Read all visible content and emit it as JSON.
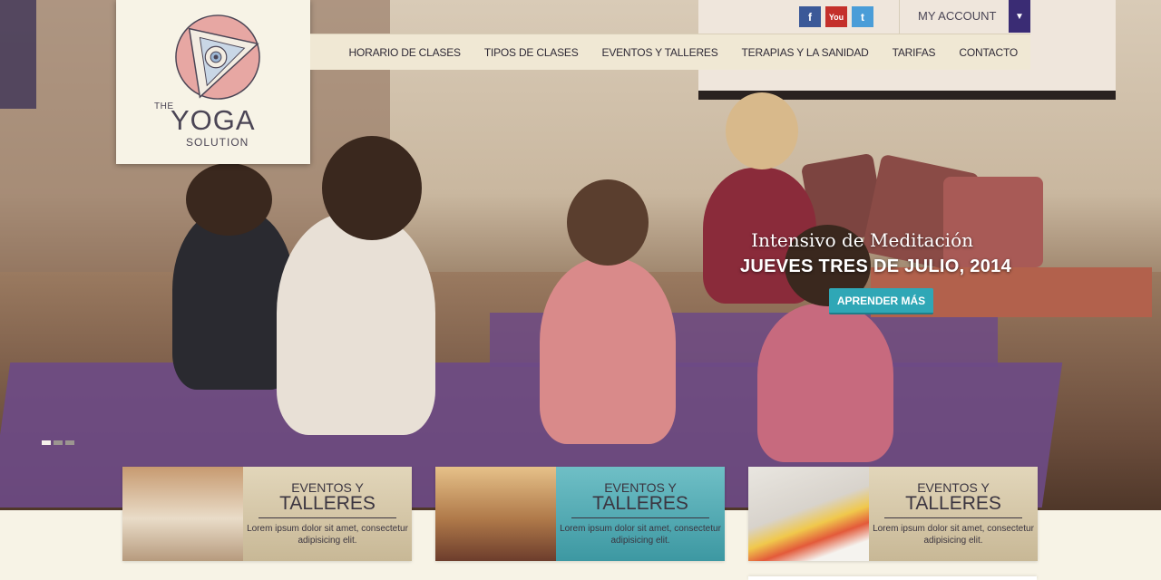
{
  "brand": {
    "the": "THE",
    "yoga": "YOGA",
    "solution": "SOLUTION",
    "colors": {
      "accent": "#2fa7b6",
      "navy": "#3a2c74",
      "cream": "#f7f3e6"
    }
  },
  "topbar": {
    "social": [
      {
        "icon": "facebook-icon",
        "glyph": "f"
      },
      {
        "icon": "youtube-icon",
        "glyph": "You"
      },
      {
        "icon": "twitter-icon",
        "glyph": "t"
      }
    ],
    "account_label": "MY ACCOUNT",
    "account_caret": "▼"
  },
  "nav": {
    "items": [
      {
        "label": "HORARIO DE CLASES"
      },
      {
        "label": "TIPOS DE CLASES"
      },
      {
        "label": "EVENTOS Y TALLERES"
      },
      {
        "label": "TERAPIAS Y LA SANIDAD"
      },
      {
        "label": "TARIFAS"
      },
      {
        "label": "CONTACTO"
      }
    ]
  },
  "hero": {
    "title": "Intensivo de Meditación",
    "date": "JUEVES TRES DE JULIO, 2014",
    "button": "APRENDER MÁS",
    "slides": 3,
    "active_slide": 1
  },
  "cards": [
    {
      "line1": "EVENTOS Y",
      "line2": "TALLERES",
      "body": "Lorem ipsum dolor sit amet, consectetur adipisicing elit."
    },
    {
      "line1": "EVENTOS Y",
      "line2": "TALLERES",
      "body": "Lorem ipsum dolor sit amet, consectetur adipisicing elit."
    },
    {
      "line1": "EVENTOS Y",
      "line2": "TALLERES",
      "body": "Lorem ipsum dolor sit amet, consectetur adipisicing elit."
    }
  ]
}
